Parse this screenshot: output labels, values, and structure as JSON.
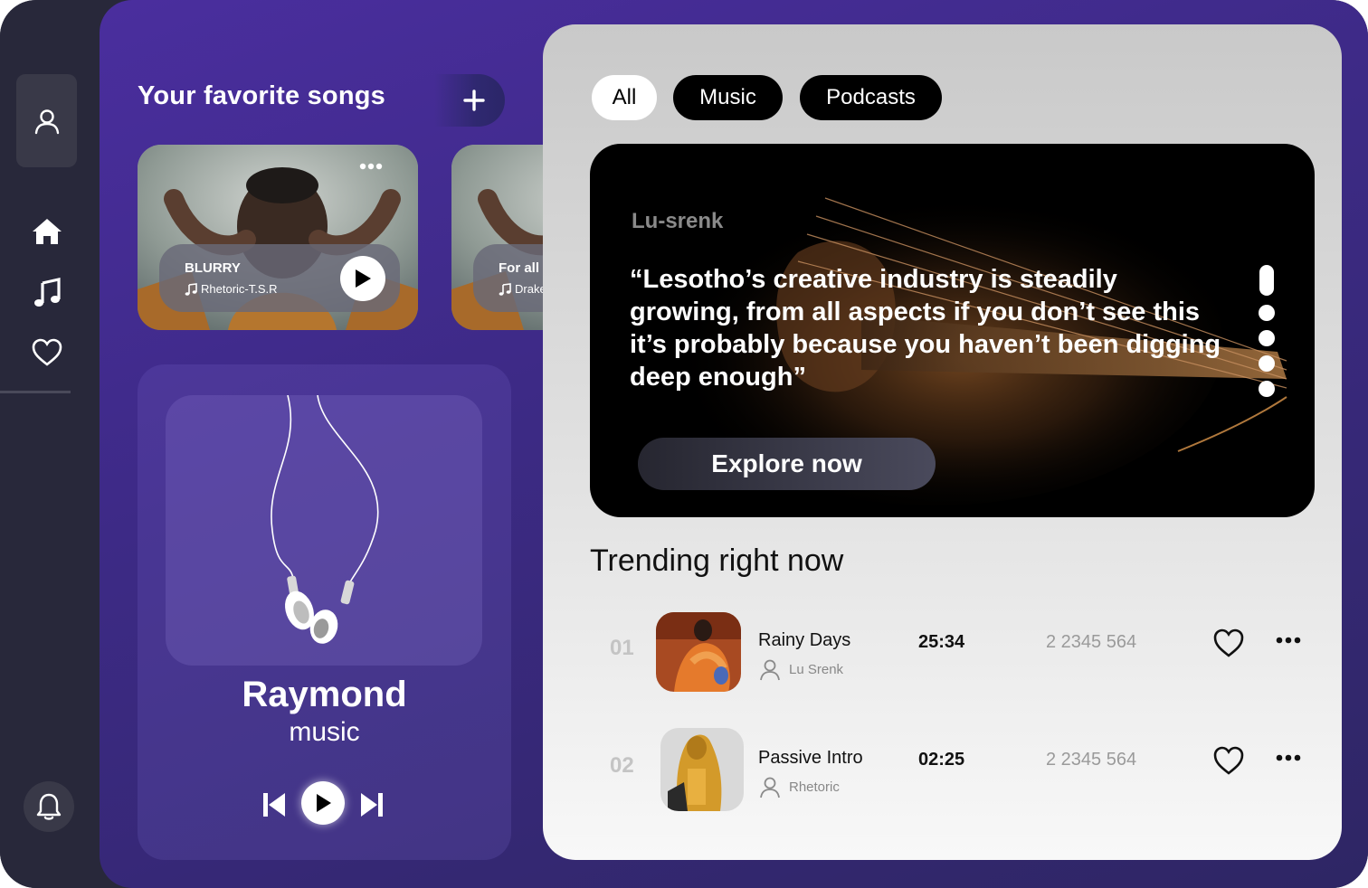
{
  "favorites": {
    "title": "Your favorite songs",
    "add_label": "+",
    "songs": [
      {
        "name": "BLURRY",
        "artist": "Rhetoric-T.S.R"
      },
      {
        "name": "For all",
        "artist": "Drake"
      }
    ]
  },
  "player": {
    "title": "Raymond",
    "subtitle": "music"
  },
  "filters": [
    "All",
    "Music",
    "Podcasts"
  ],
  "hero": {
    "author": "Lu-srenk",
    "quote": "“Lesotho’s creative industry is steadily growing, from all aspects if you don’t see this it’s probably because you haven’t been digging deep enough”",
    "button": "Explore now"
  },
  "trending": {
    "title": "Trending right now",
    "rows": [
      {
        "num": "01",
        "title": "Rainy Days",
        "artist": "Lu Srenk",
        "duration": "25:34",
        "plays": "2 2345 564"
      },
      {
        "num": "02",
        "title": "Passive Intro",
        "artist": "Rhetoric",
        "duration": "02:25",
        "plays": "2 2345 564"
      }
    ]
  },
  "colors": {
    "sidebar": "#28283a",
    "purple": "#4a2e9e",
    "panel": "#e2e2e2",
    "hero": "#000000"
  }
}
